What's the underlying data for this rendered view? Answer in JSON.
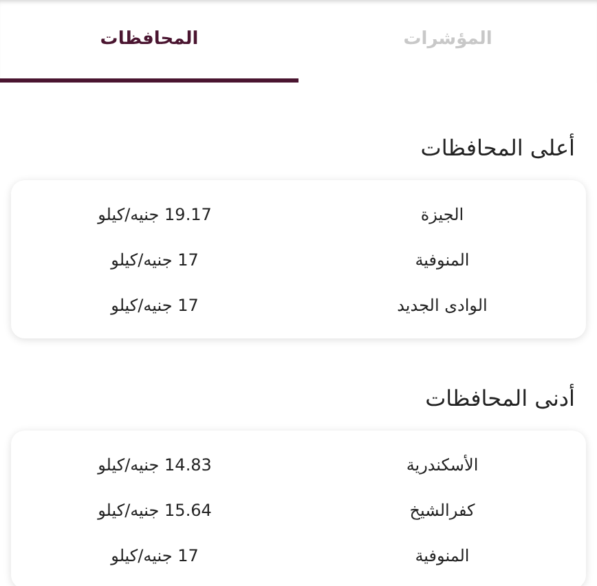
{
  "tabs": [
    {
      "label": "المؤشرات",
      "selected": false
    },
    {
      "label": "المحافظات",
      "selected": true
    }
  ],
  "sections": [
    {
      "title": "أعلى المحافظات",
      "rows": [
        {
          "province": "الجيزة",
          "price": "19.17 جنيه/كيلو"
        },
        {
          "province": "المنوفية",
          "price": "17 جنيه/كيلو"
        },
        {
          "province": "الوادى الجديد",
          "price": "17 جنيه/كيلو"
        }
      ]
    },
    {
      "title": "أدنى المحافظات",
      "rows": [
        {
          "province": "الأسكندرية",
          "price": "14.83 جنيه/كيلو"
        },
        {
          "province": "كفرالشيخ",
          "price": "15.64 جنيه/كيلو"
        },
        {
          "province": "المنوفية",
          "price": "17 جنيه/كيلو"
        }
      ]
    }
  ]
}
